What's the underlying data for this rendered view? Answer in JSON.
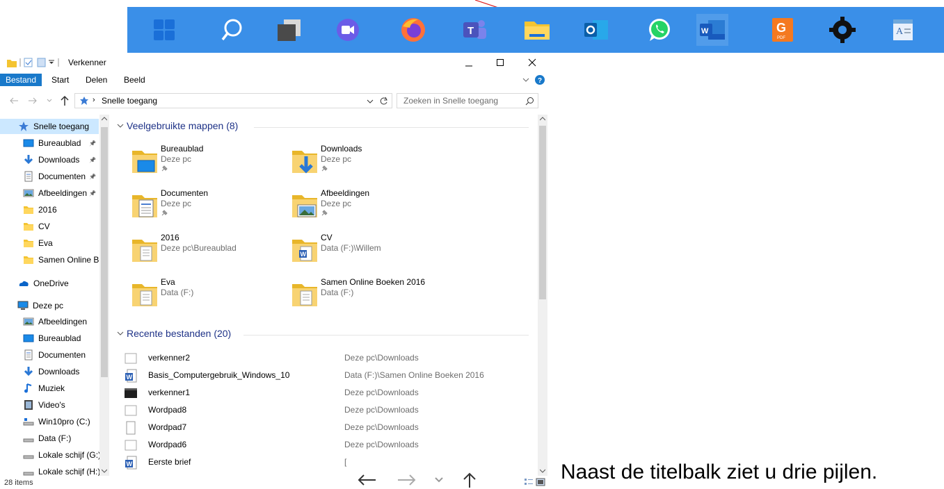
{
  "window": {
    "title": "Verkenner"
  },
  "ribbon": {
    "tabs": [
      "Bestand",
      "Start",
      "Delen",
      "Beeld"
    ]
  },
  "address": {
    "path": "Snelle toegang",
    "search_placeholder": "Zoeken in Snelle toegang"
  },
  "nav": {
    "quick_access": "Snelle toegang",
    "quick_items": [
      {
        "label": "Bureaublad",
        "icon": "desktop-icon",
        "pinned": true
      },
      {
        "label": "Downloads",
        "icon": "download-icon",
        "pinned": true
      },
      {
        "label": "Documenten",
        "icon": "document-icon",
        "pinned": true
      },
      {
        "label": "Afbeeldingen",
        "icon": "pictures-icon",
        "pinned": true
      },
      {
        "label": "2016",
        "icon": "folder-icon",
        "pinned": false
      },
      {
        "label": "CV",
        "icon": "folder-icon",
        "pinned": false
      },
      {
        "label": "Eva",
        "icon": "folder-icon",
        "pinned": false
      },
      {
        "label": "Samen Online Bo",
        "icon": "folder-icon",
        "pinned": false
      }
    ],
    "onedrive": "OneDrive",
    "this_pc": "Deze pc",
    "pc_items": [
      {
        "label": "Afbeeldingen",
        "icon": "pictures-icon"
      },
      {
        "label": "Bureaublad",
        "icon": "desktop-icon"
      },
      {
        "label": "Documenten",
        "icon": "document-icon"
      },
      {
        "label": "Downloads",
        "icon": "download-icon"
      },
      {
        "label": "Muziek",
        "icon": "music-icon"
      },
      {
        "label": "Video's",
        "icon": "video-icon"
      },
      {
        "label": "Win10pro (C:)",
        "icon": "system-drive-icon"
      },
      {
        "label": "Data (F:)",
        "icon": "drive-icon"
      },
      {
        "label": "Lokale schijf (G:)",
        "icon": "drive-icon"
      },
      {
        "label": "Lokale schijf (H:)",
        "icon": "drive-icon"
      }
    ]
  },
  "frequent": {
    "header": "Veelgebruikte mappen (8)",
    "folders": [
      {
        "name": "Bureaublad",
        "location": "Deze pc",
        "pinned": true,
        "overlay": "desktop"
      },
      {
        "name": "Downloads",
        "location": "Deze pc",
        "pinned": true,
        "overlay": "download"
      },
      {
        "name": "Documenten",
        "location": "Deze pc",
        "pinned": true,
        "overlay": "document"
      },
      {
        "name": "Afbeeldingen",
        "location": "Deze pc",
        "pinned": true,
        "overlay": "pictures"
      },
      {
        "name": "2016",
        "location": "Deze pc\\Bureaublad",
        "pinned": false,
        "overlay": "pages"
      },
      {
        "name": "CV",
        "location": "Data (F:)\\Willem",
        "pinned": false,
        "overlay": "word"
      },
      {
        "name": "Eva",
        "location": "Data (F:)",
        "pinned": false,
        "overlay": "pages"
      },
      {
        "name": "Samen Online Boeken 2016",
        "location": "Data (F:)",
        "pinned": false,
        "overlay": "pages"
      }
    ]
  },
  "recent": {
    "header": "Recente bestanden (20)",
    "files": [
      {
        "name": "verkenner2",
        "location": "Deze pc\\Downloads",
        "icon": "image-file-icon"
      },
      {
        "name": "Basis_Computergebruik_Windows_10",
        "location": "Data (F:)\\Samen Online Boeken 2016",
        "icon": "word-file-icon"
      },
      {
        "name": "verkenner1",
        "location": "Deze pc\\Downloads",
        "icon": "image-file-icon"
      },
      {
        "name": "Wordpad8",
        "location": "Deze pc\\Downloads",
        "icon": "image-file-icon"
      },
      {
        "name": "Wordpad7",
        "location": "Deze pc\\Downloads",
        "icon": "blank-file-icon"
      },
      {
        "name": "Wordpad6",
        "location": "Deze pc\\Downloads",
        "icon": "image-file-icon"
      },
      {
        "name": "Eerste brief",
        "location": "[",
        "icon": "word-file-icon"
      }
    ]
  },
  "status": {
    "items": "28 items"
  },
  "caption": "Naast de titelbalk ziet u drie pijlen.",
  "colors": {
    "taskbar": "#3a8fe8",
    "accent": "#1979ca",
    "folder": "#f4c431",
    "group_header": "#1e3287",
    "selection": "#cce8ff"
  }
}
